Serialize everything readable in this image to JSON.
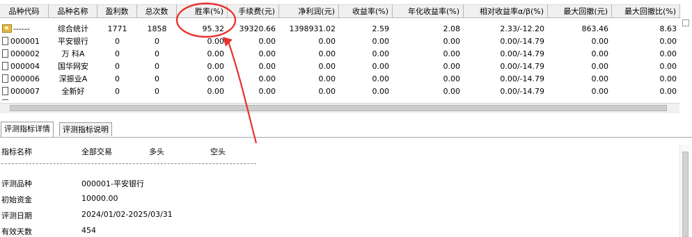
{
  "table": {
    "columns": [
      "品种代码",
      "品种名称",
      "盈利数",
      "总次数",
      "胜率(%)",
      "手续费(元)",
      "净利润(元)",
      "收益率(%)",
      "年化收益率(%)",
      "相对收益率α/β(%)",
      "最大回撤(元)",
      "最大回撤比(%)"
    ],
    "rows": [
      {
        "code": "------",
        "name": "综合统计",
        "wins": "1771",
        "total": "1858",
        "winrate": "95.32",
        "fee": "39320.66",
        "profit": "1398931.02",
        "ret": "2.59",
        "annual": "2.08",
        "rel": "2.33/-12.20",
        "dd": "863.46",
        "ddratio": "8.63",
        "icon": "summary-icon"
      },
      {
        "code": "000001",
        "name": "平安银行",
        "wins": "0",
        "total": "0",
        "winrate": "0.00",
        "fee": "0.00",
        "profit": "0.00",
        "ret": "0.00",
        "annual": "0.00",
        "rel": "0.00/-14.79",
        "dd": "0.00",
        "ddratio": "0.00",
        "icon": "document-icon"
      },
      {
        "code": "000002",
        "name": "万 科A",
        "wins": "0",
        "total": "0",
        "winrate": "0.00",
        "fee": "0.00",
        "profit": "0.00",
        "ret": "0.00",
        "annual": "0.00",
        "rel": "0.00/-14.79",
        "dd": "0.00",
        "ddratio": "0.00",
        "icon": "document-icon"
      },
      {
        "code": "000004",
        "name": "国华网安",
        "wins": "0",
        "total": "0",
        "winrate": "0.00",
        "fee": "0.00",
        "profit": "0.00",
        "ret": "0.00",
        "annual": "0.00",
        "rel": "0.00/-14.79",
        "dd": "0.00",
        "ddratio": "0.00",
        "icon": "document-icon"
      },
      {
        "code": "000006",
        "name": "深振业A",
        "wins": "0",
        "total": "0",
        "winrate": "0.00",
        "fee": "0.00",
        "profit": "0.00",
        "ret": "0.00",
        "annual": "0.00",
        "rel": "0.00/-14.79",
        "dd": "0.00",
        "ddratio": "0.00",
        "icon": "document-icon"
      },
      {
        "code": "000007",
        "name": "全新好",
        "wins": "0",
        "total": "0",
        "winrate": "0.00",
        "fee": "0.00",
        "profit": "0.00",
        "ret": "0.00",
        "annual": "0.00",
        "rel": "0.00/-14.79",
        "dd": "0.00",
        "ddratio": "0.00",
        "icon": "document-icon"
      }
    ]
  },
  "tabs": [
    {
      "label": "评测指标详情",
      "active": true
    },
    {
      "label": "评测指标说明",
      "active": false
    }
  ],
  "detail": {
    "headers": [
      "指标名称",
      "全部交易",
      "多头",
      "空头"
    ],
    "rows": [
      {
        "label": "评测品种",
        "value": "000001-平安银行"
      },
      {
        "label": "初始资金",
        "value": "10000.00"
      },
      {
        "label": "评测日期",
        "value": "2024/01/02-2025/03/31"
      },
      {
        "label": "有效天数",
        "value": "454"
      }
    ]
  },
  "annotation": {
    "color": "#e8322f"
  }
}
